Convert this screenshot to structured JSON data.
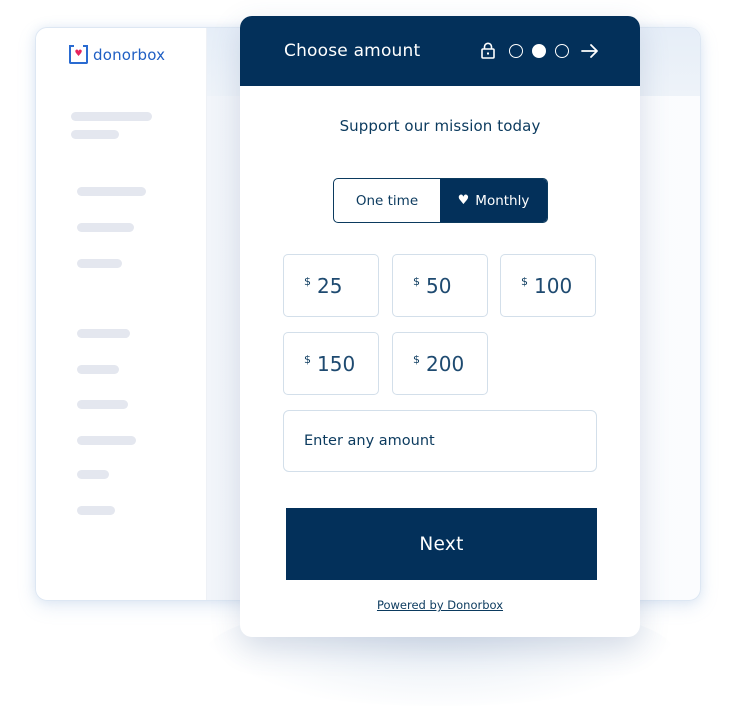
{
  "app": {
    "brand": "donorbox",
    "sidebar_placeholder_lines": 12
  },
  "form": {
    "header": {
      "title": "Choose amount",
      "lock_icon": "lock-icon",
      "steps": [
        {
          "state": "inactive"
        },
        {
          "state": "active"
        },
        {
          "state": "inactive"
        }
      ],
      "next_icon": "arrow-right-icon"
    },
    "subtitle": "Support our mission today",
    "frequency": {
      "options": [
        {
          "label": "One time",
          "selected": false
        },
        {
          "label": "Monthly",
          "selected": true,
          "icon": "heart-icon"
        }
      ]
    },
    "currency_symbol": "$",
    "amounts": [
      "25",
      "50",
      "100",
      "150",
      "200"
    ],
    "custom_amount": {
      "placeholder": "Enter any amount",
      "value": ""
    },
    "next_label": "Next",
    "powered_by": "Powered by Donorbox"
  },
  "colors": {
    "primary": "#03305a",
    "text": "#0b3a5e",
    "border": "#d3dfea",
    "brand_blue": "#1f5fc4",
    "brand_heart": "#e6245e",
    "skeleton": "#e4e7ef"
  }
}
